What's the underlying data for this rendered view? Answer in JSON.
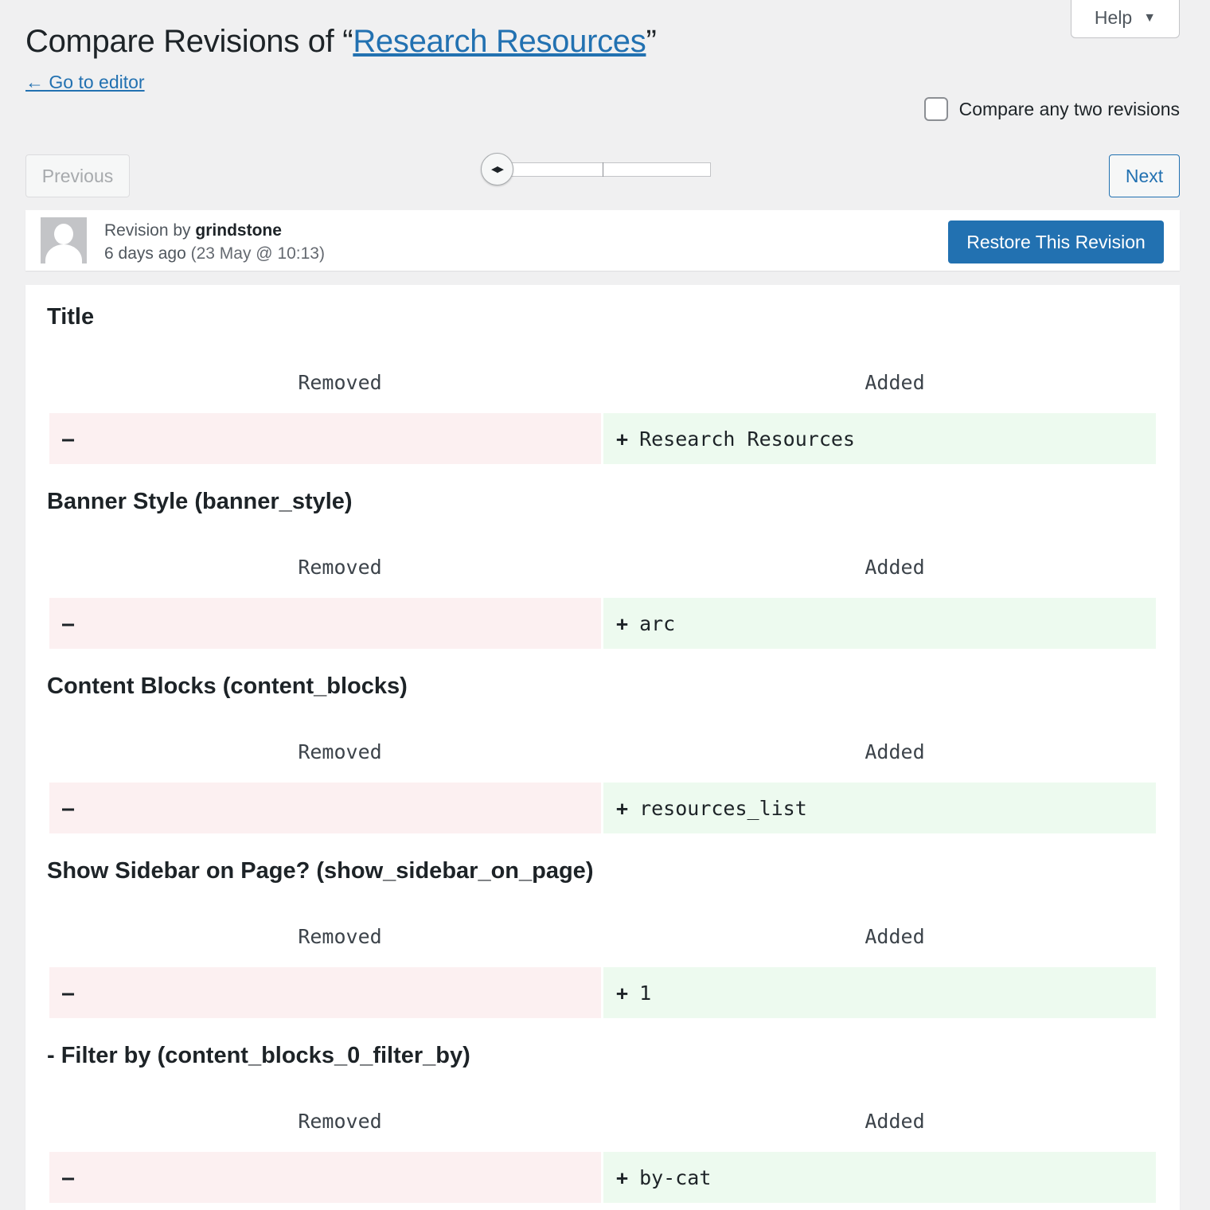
{
  "help": {
    "label": "Help",
    "caret": "▼"
  },
  "header": {
    "title_prefix": "Compare Revisions of “",
    "title_link": "Research Resources",
    "title_suffix": "”",
    "back_link": "← Go to editor"
  },
  "compare_any": {
    "label": "Compare any two revisions",
    "checked": false
  },
  "nav": {
    "previous": "Previous",
    "next": "Next"
  },
  "slider": {
    "handle_glyph": "◀▶",
    "position": 0,
    "total_revisions": 3
  },
  "meta": {
    "revision_by_label": "Revision by",
    "author": "grindstone",
    "time_ago": "6 days ago",
    "date": "(23 May @ 10:13)",
    "restore_label": "Restore This Revision"
  },
  "columns": {
    "removed": "Removed",
    "added": "Added"
  },
  "signs": {
    "removed": "–",
    "added": "+"
  },
  "fields": [
    {
      "title": "Title",
      "removed": "",
      "added": "Research Resources"
    },
    {
      "title": "Banner Style (banner_style)",
      "removed": "",
      "added": "arc"
    },
    {
      "title": "Content Blocks (content_blocks)",
      "removed": "",
      "added": "resources_list"
    },
    {
      "title": "Show Sidebar on Page? (show_sidebar_on_page)",
      "removed": "",
      "added": "1"
    },
    {
      "title": "- Filter by (content_blocks_0_filter_by)",
      "removed": "",
      "added": "by-cat"
    }
  ],
  "colors": {
    "link": "#2271b1",
    "primary_button": "#2271b1",
    "removed_bg": "#fcf0f1",
    "added_bg": "#edfaef"
  }
}
